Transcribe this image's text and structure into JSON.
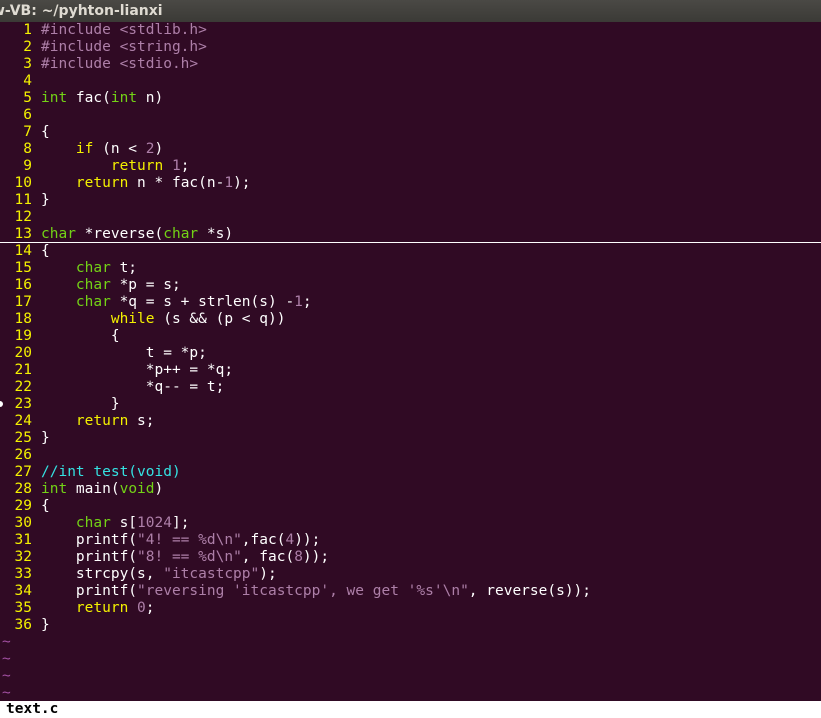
{
  "window": {
    "title": "w-VB: ~/pyhton-lianxi"
  },
  "editor": {
    "filename": "text.c",
    "cursor_line": 13,
    "lines": [
      {
        "n": "1",
        "tokens": [
          {
            "t": "#include ",
            "c": "kw-pre"
          },
          {
            "t": "<stdlib.h>",
            "c": "lit-str"
          }
        ]
      },
      {
        "n": "2",
        "tokens": [
          {
            "t": "#include ",
            "c": "kw-pre"
          },
          {
            "t": "<string.h>",
            "c": "lit-str"
          }
        ]
      },
      {
        "n": "3",
        "tokens": [
          {
            "t": "#include ",
            "c": "kw-pre"
          },
          {
            "t": "<stdio.h>",
            "c": "lit-str"
          }
        ]
      },
      {
        "n": "4",
        "tokens": []
      },
      {
        "n": "5",
        "tokens": [
          {
            "t": "int",
            "c": "kw-type"
          },
          {
            "t": " fac(",
            "c": ""
          },
          {
            "t": "int",
            "c": "kw-type"
          },
          {
            "t": " n)",
            "c": ""
          }
        ]
      },
      {
        "n": "6",
        "tokens": []
      },
      {
        "n": "7",
        "tokens": [
          {
            "t": "{",
            "c": ""
          }
        ]
      },
      {
        "n": "8",
        "tokens": [
          {
            "t": "    ",
            "c": ""
          },
          {
            "t": "if",
            "c": "kw-stmt"
          },
          {
            "t": " (n < ",
            "c": ""
          },
          {
            "t": "2",
            "c": "lit-num"
          },
          {
            "t": ")",
            "c": ""
          }
        ]
      },
      {
        "n": "9",
        "tokens": [
          {
            "t": "        ",
            "c": ""
          },
          {
            "t": "return",
            "c": "kw-stmt"
          },
          {
            "t": " ",
            "c": ""
          },
          {
            "t": "1",
            "c": "lit-num"
          },
          {
            "t": ";",
            "c": ""
          }
        ]
      },
      {
        "n": "10",
        "tokens": [
          {
            "t": "    ",
            "c": ""
          },
          {
            "t": "return",
            "c": "kw-stmt"
          },
          {
            "t": " n * fac(n-",
            "c": ""
          },
          {
            "t": "1",
            "c": "lit-num"
          },
          {
            "t": ");",
            "c": ""
          }
        ]
      },
      {
        "n": "11",
        "tokens": [
          {
            "t": "}",
            "c": ""
          }
        ]
      },
      {
        "n": "12",
        "tokens": []
      },
      {
        "n": "13",
        "tokens": [
          {
            "t": "char",
            "c": "kw-type"
          },
          {
            "t": " *reverse(",
            "c": ""
          },
          {
            "t": "char",
            "c": "kw-type"
          },
          {
            "t": " *s)",
            "c": ""
          }
        ]
      },
      {
        "n": "14",
        "tokens": [
          {
            "t": "{",
            "c": ""
          }
        ]
      },
      {
        "n": "15",
        "tokens": [
          {
            "t": "    ",
            "c": ""
          },
          {
            "t": "char",
            "c": "kw-type"
          },
          {
            "t": " t;",
            "c": ""
          }
        ]
      },
      {
        "n": "16",
        "tokens": [
          {
            "t": "    ",
            "c": ""
          },
          {
            "t": "char",
            "c": "kw-type"
          },
          {
            "t": " *p = s;",
            "c": ""
          }
        ]
      },
      {
        "n": "17",
        "tokens": [
          {
            "t": "    ",
            "c": ""
          },
          {
            "t": "char",
            "c": "kw-type"
          },
          {
            "t": " *q = s + strlen(s) -",
            "c": ""
          },
          {
            "t": "1",
            "c": "lit-num"
          },
          {
            "t": ";",
            "c": ""
          }
        ]
      },
      {
        "n": "18",
        "tokens": [
          {
            "t": "        ",
            "c": ""
          },
          {
            "t": "while",
            "c": "kw-stmt"
          },
          {
            "t": " (s && (p < q))",
            "c": ""
          }
        ]
      },
      {
        "n": "19",
        "tokens": [
          {
            "t": "        {",
            "c": ""
          }
        ]
      },
      {
        "n": "20",
        "tokens": [
          {
            "t": "            t = *p;",
            "c": ""
          }
        ]
      },
      {
        "n": "21",
        "tokens": [
          {
            "t": "            *p++ = *q;",
            "c": ""
          }
        ]
      },
      {
        "n": "22",
        "tokens": [
          {
            "t": "            *q-- = t;",
            "c": ""
          }
        ]
      },
      {
        "n": "23",
        "tokens": [
          {
            "t": "        }",
            "c": ""
          }
        ]
      },
      {
        "n": "24",
        "tokens": [
          {
            "t": "    ",
            "c": ""
          },
          {
            "t": "return",
            "c": "kw-stmt"
          },
          {
            "t": " s;",
            "c": ""
          }
        ]
      },
      {
        "n": "25",
        "tokens": [
          {
            "t": "}",
            "c": ""
          }
        ]
      },
      {
        "n": "26",
        "tokens": []
      },
      {
        "n": "27",
        "tokens": [
          {
            "t": "//int test(void)",
            "c": "comment"
          }
        ]
      },
      {
        "n": "28",
        "tokens": [
          {
            "t": "int",
            "c": "kw-type"
          },
          {
            "t": " main(",
            "c": ""
          },
          {
            "t": "void",
            "c": "kw-type"
          },
          {
            "t": ")",
            "c": ""
          }
        ]
      },
      {
        "n": "29",
        "tokens": [
          {
            "t": "{",
            "c": ""
          }
        ]
      },
      {
        "n": "30",
        "tokens": [
          {
            "t": "    ",
            "c": ""
          },
          {
            "t": "char",
            "c": "kw-type"
          },
          {
            "t": " s[",
            "c": ""
          },
          {
            "t": "1024",
            "c": "lit-num"
          },
          {
            "t": "];",
            "c": ""
          }
        ]
      },
      {
        "n": "31",
        "tokens": [
          {
            "t": "    printf(",
            "c": ""
          },
          {
            "t": "\"4! == ",
            "c": "lit-str"
          },
          {
            "t": "%d\\n",
            "c": "kw-pre"
          },
          {
            "t": "\"",
            "c": "lit-str"
          },
          {
            "t": ",fac(",
            "c": ""
          },
          {
            "t": "4",
            "c": "lit-num"
          },
          {
            "t": "));",
            "c": ""
          }
        ]
      },
      {
        "n": "32",
        "tokens": [
          {
            "t": "    printf(",
            "c": ""
          },
          {
            "t": "\"8! == ",
            "c": "lit-str"
          },
          {
            "t": "%d\\n",
            "c": "kw-pre"
          },
          {
            "t": "\"",
            "c": "lit-str"
          },
          {
            "t": ", fac(",
            "c": ""
          },
          {
            "t": "8",
            "c": "lit-num"
          },
          {
            "t": "));",
            "c": ""
          }
        ]
      },
      {
        "n": "33",
        "tokens": [
          {
            "t": "    strcpy(s, ",
            "c": ""
          },
          {
            "t": "\"itcastcpp\"",
            "c": "lit-str"
          },
          {
            "t": ");",
            "c": ""
          }
        ]
      },
      {
        "n": "34",
        "tokens": [
          {
            "t": "    printf(",
            "c": ""
          },
          {
            "t": "\"reversing 'itcastcpp', we get '",
            "c": "lit-str"
          },
          {
            "t": "%s",
            "c": "kw-pre"
          },
          {
            "t": "'",
            "c": "lit-str"
          },
          {
            "t": "\\n",
            "c": "kw-pre"
          },
          {
            "t": "\"",
            "c": "lit-str"
          },
          {
            "t": ", reverse(s));",
            "c": ""
          }
        ]
      },
      {
        "n": "35",
        "tokens": [
          {
            "t": "    ",
            "c": ""
          },
          {
            "t": "return",
            "c": "kw-stmt"
          },
          {
            "t": " ",
            "c": ""
          },
          {
            "t": "0",
            "c": "lit-num"
          },
          {
            "t": ";",
            "c": ""
          }
        ]
      },
      {
        "n": "36",
        "tokens": [
          {
            "t": "}",
            "c": ""
          }
        ]
      }
    ],
    "filler": [
      "~",
      "~",
      "~",
      "~"
    ]
  },
  "colors": {
    "background": "#300a24",
    "line_number": "#f4f100",
    "type_keyword": "#73d216",
    "statement_keyword": "#f4f100",
    "preprocessor": "#ad7fa8",
    "literal": "#ad7fa8",
    "comment": "#34e2e2",
    "filler_tilde": "#a14fa1"
  }
}
